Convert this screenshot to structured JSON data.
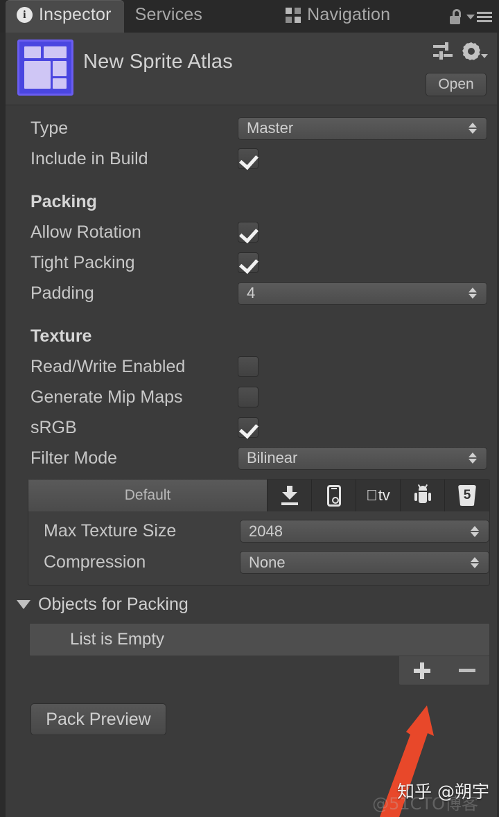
{
  "window": {
    "tabs": [
      {
        "label": "Inspector",
        "icon": "info-circle-icon",
        "active": true
      },
      {
        "label": "Services",
        "icon": "",
        "active": false
      },
      {
        "label": "Navigation",
        "icon": "navmesh-icon",
        "active": false
      }
    ],
    "lock_icon": "lock-open-icon",
    "menu_icon": "hamburger-menu-icon"
  },
  "object_header": {
    "title": "New Sprite Atlas",
    "thumbnail_icon": "sprite-atlas-icon",
    "accent_color": "#6a5df0",
    "preset_icon": "preset-sliders-icon",
    "gear_icon": "gear-icon",
    "open_label": "Open"
  },
  "properties": {
    "type": {
      "label": "Type",
      "value": "Master"
    },
    "include_in_build": {
      "label": "Include in Build",
      "checked": true
    },
    "packing_header": "Packing",
    "allow_rotation": {
      "label": "Allow Rotation",
      "checked": true
    },
    "tight_packing": {
      "label": "Tight Packing",
      "checked": true
    },
    "padding": {
      "label": "Padding",
      "value": "4"
    },
    "texture_header": "Texture",
    "read_write_enabled": {
      "label": "Read/Write Enabled",
      "checked": false
    },
    "generate_mip_maps": {
      "label": "Generate Mip Maps",
      "checked": false
    },
    "srgb": {
      "label": "sRGB",
      "checked": true
    },
    "filter_mode": {
      "label": "Filter Mode",
      "value": "Bilinear"
    }
  },
  "platform_tabs": [
    {
      "label": "Default",
      "icon": "",
      "active": true
    },
    {
      "label": "",
      "icon": "standalone-download-icon",
      "active": false
    },
    {
      "label": "",
      "icon": "ios-phone-icon",
      "active": false
    },
    {
      "label": "tv",
      "icon": "apple-tv-icon",
      "active": false
    },
    {
      "label": "",
      "icon": "android-robot-icon",
      "active": false
    },
    {
      "label": "5",
      "icon": "html5-webgl-icon",
      "active": false
    }
  ],
  "platform_settings": {
    "max_texture_size": {
      "label": "Max Texture Size",
      "value": "2048"
    },
    "compression": {
      "label": "Compression",
      "value": "None"
    }
  },
  "objects_for_packing": {
    "foldout_label": "Objects for Packing",
    "expanded": true,
    "empty_text": "List is Empty",
    "add_icon": "plus-icon",
    "remove_icon": "minus-icon"
  },
  "pack_preview": {
    "label": "Pack Preview"
  },
  "annotation": {
    "arrow_color": "#e8482a",
    "points_at": "add-object-button"
  },
  "watermarks": {
    "zhihu": "知乎 @朔宇",
    "cto": "@51CTO博客"
  }
}
